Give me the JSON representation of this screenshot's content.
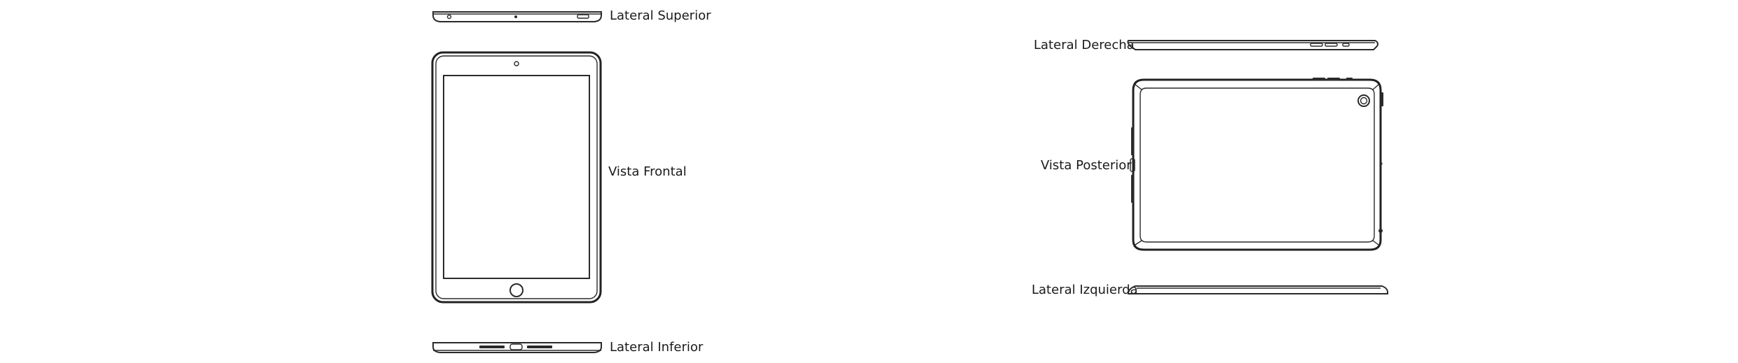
{
  "labels": {
    "top_side": "Lateral Superior",
    "front_view": "Vista Frontal",
    "bottom_side": "Lateral Inferior",
    "right_side": "Lateral Derecha",
    "back_view": "Vista Posterior",
    "left_side": "Lateral Izquierda"
  },
  "colors": {
    "line": "#2a2a2a",
    "text": "#1a1a1a",
    "background": "#ffffff"
  }
}
